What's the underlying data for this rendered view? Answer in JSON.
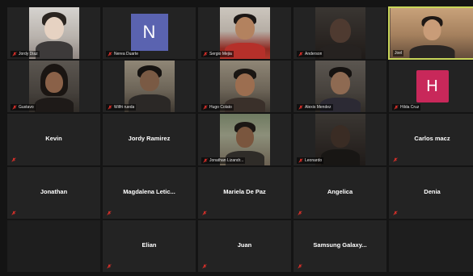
{
  "colors": {
    "active_speaker_border": "#c9d65a",
    "muted_icon": "#e0302a",
    "tile_bg": "#232323",
    "avatar_n_bg": "#5a63b0",
    "avatar_h_bg": "#c8285a"
  },
  "tiles": [
    {
      "name": "Jordy Diaz",
      "type": "video",
      "muted": true
    },
    {
      "name": "Nerea Duarte",
      "type": "avatar",
      "initial": "N",
      "muted": true
    },
    {
      "name": "Sergio Mejia",
      "type": "video",
      "muted": true
    },
    {
      "name": "Anderson",
      "type": "video",
      "muted": true
    },
    {
      "name": "Joel",
      "type": "video",
      "active": true,
      "muted": false
    },
    {
      "name": "Gustavo",
      "type": "video",
      "muted": true
    },
    {
      "name": "Wilfri rueda",
      "type": "video",
      "muted": true
    },
    {
      "name": "Hugo Colato",
      "type": "video",
      "muted": true
    },
    {
      "name": "Alexis Mendez",
      "type": "video",
      "muted": true
    },
    {
      "name": "Hilda Cruz",
      "type": "avatar",
      "initial": "H",
      "muted": true
    },
    {
      "name": "Kevin",
      "type": "name",
      "muted": true
    },
    {
      "name": "Jordy Ramirez",
      "type": "name",
      "muted": false
    },
    {
      "name": "Jonathan Lizandr...",
      "type": "video",
      "muted": true
    },
    {
      "name": "Leonardo",
      "type": "video",
      "muted": true
    },
    {
      "name": "Carlos macz",
      "type": "name",
      "muted": true
    },
    {
      "name": "Jonathan",
      "type": "name",
      "muted": true
    },
    {
      "name": "Magdalena Letic...",
      "type": "name",
      "muted": true
    },
    {
      "name": "Mariela De Paz",
      "type": "name",
      "muted": true
    },
    {
      "name": "Angelica",
      "type": "name",
      "muted": true
    },
    {
      "name": "Denia",
      "type": "name",
      "muted": true
    },
    {
      "name": "",
      "type": "empty"
    },
    {
      "name": "Elian",
      "type": "name",
      "muted": true
    },
    {
      "name": "Juan",
      "type": "name",
      "muted": true
    },
    {
      "name": "Samsung Galaxy...",
      "type": "name",
      "muted": true
    },
    {
      "name": "",
      "type": "empty"
    }
  ]
}
